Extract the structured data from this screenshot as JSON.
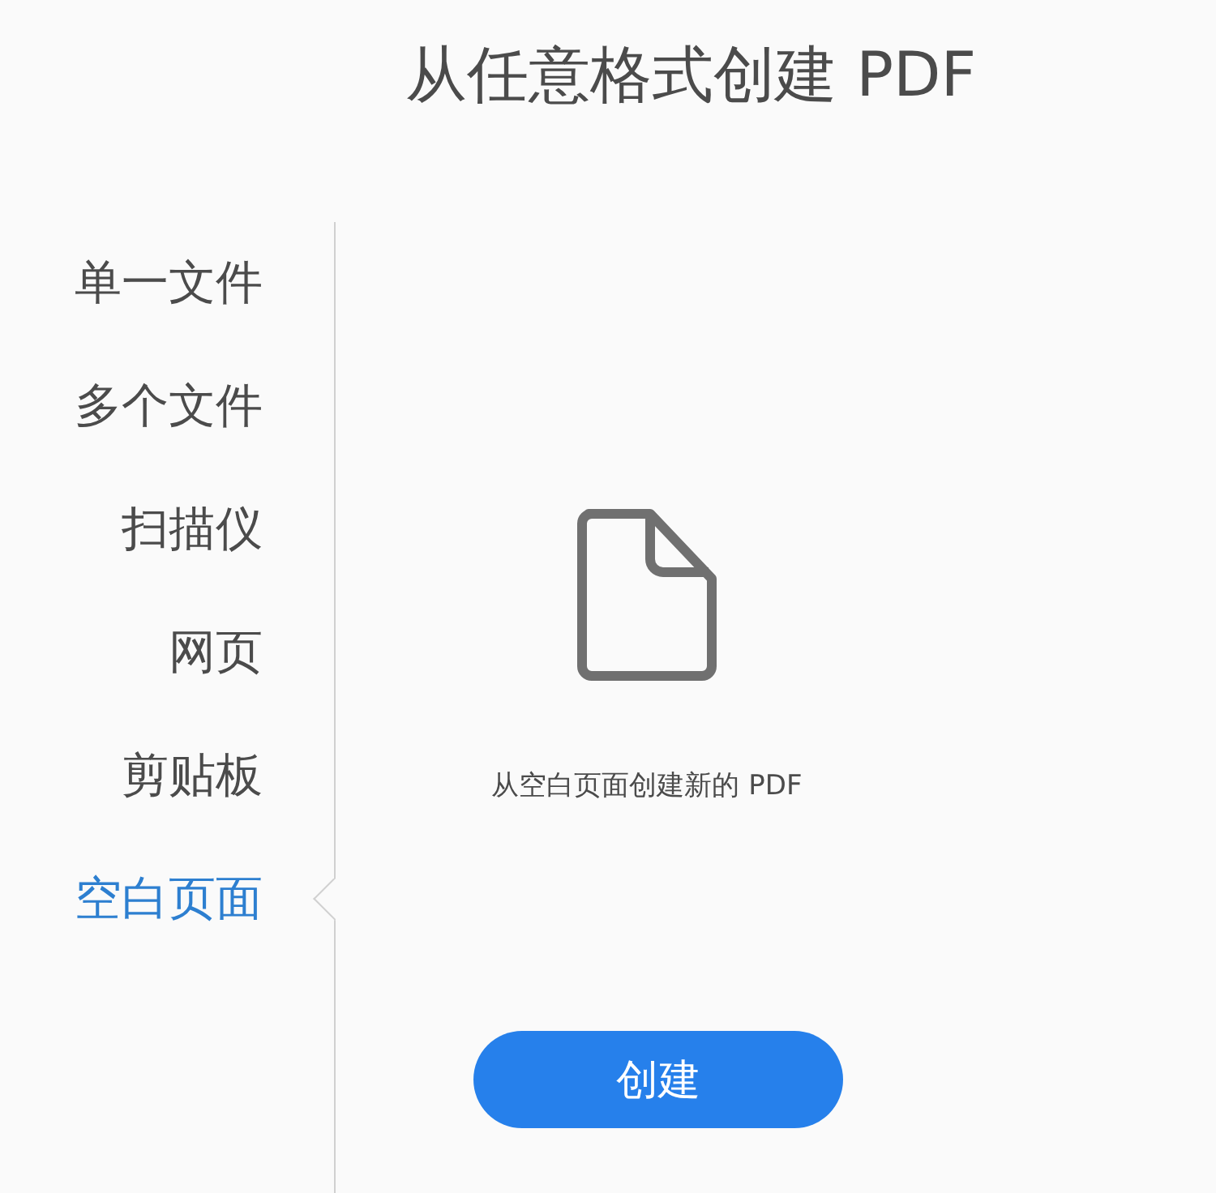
{
  "title": "从任意格式创建 PDF",
  "sidebar": {
    "items": [
      {
        "label": "单一文件",
        "selected": false
      },
      {
        "label": "多个文件",
        "selected": false
      },
      {
        "label": "扫描仪",
        "selected": false
      },
      {
        "label": "网页",
        "selected": false
      },
      {
        "label": "剪贴板",
        "selected": false
      },
      {
        "label": "空白页面",
        "selected": true
      }
    ]
  },
  "content": {
    "description": "从空白页面创建新的 PDF",
    "button": "创建"
  }
}
